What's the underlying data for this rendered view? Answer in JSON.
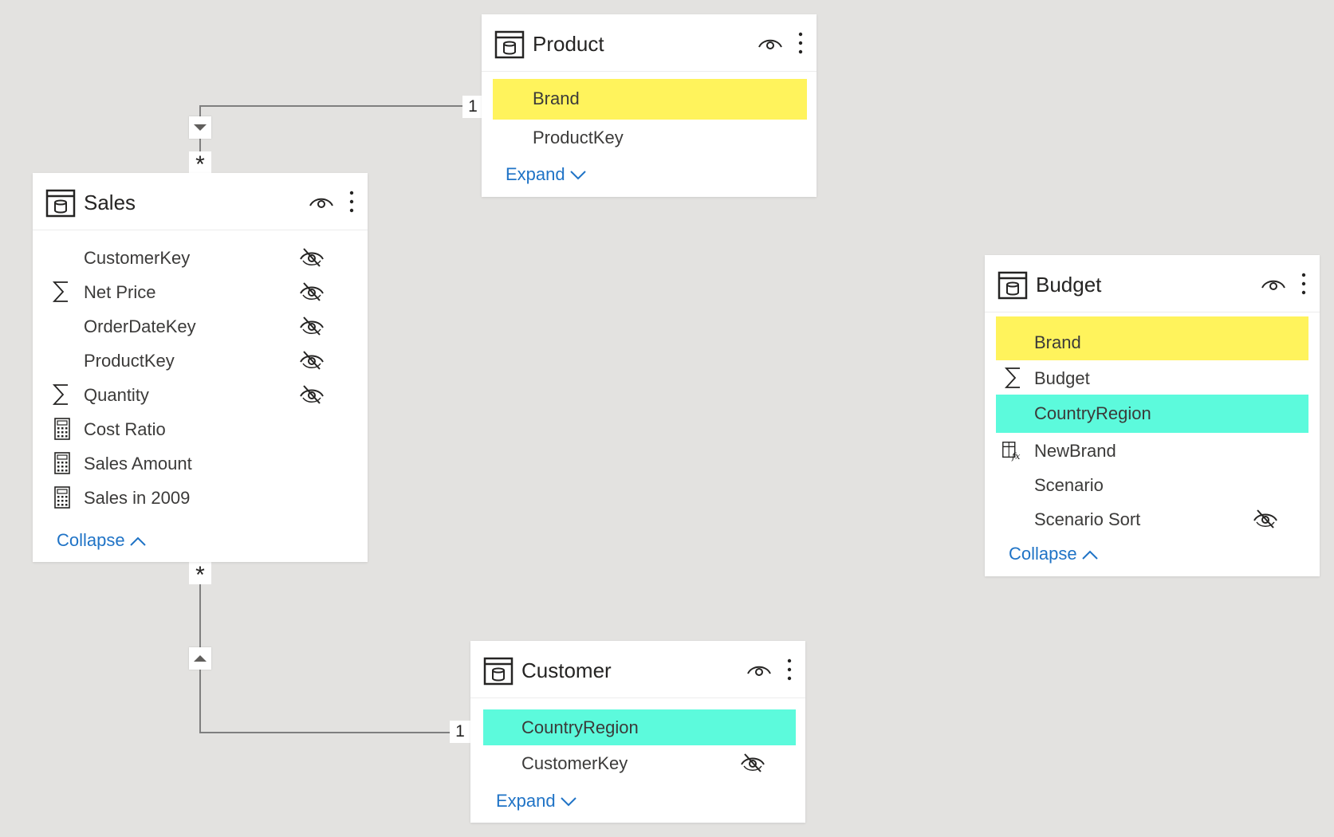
{
  "tables": {
    "product": {
      "title": "Product",
      "fields": [
        {
          "label": "Brand",
          "highlight": "#fff35c"
        },
        {
          "label": "ProductKey"
        }
      ],
      "toggle": "Expand"
    },
    "sales": {
      "title": "Sales",
      "fields": [
        {
          "label": "CustomerKey",
          "hidden": true
        },
        {
          "label": "Net Price",
          "icon": "sigma-icon",
          "hidden": true
        },
        {
          "label": "OrderDateKey",
          "hidden": true
        },
        {
          "label": "ProductKey",
          "hidden": true
        },
        {
          "label": "Quantity",
          "icon": "sigma-icon",
          "hidden": true
        },
        {
          "label": "Cost Ratio",
          "icon": "calculator-icon"
        },
        {
          "label": "Sales Amount",
          "icon": "calculator-icon"
        },
        {
          "label": "Sales in 2009",
          "icon": "calculator-icon"
        }
      ],
      "toggle": "Collapse"
    },
    "budget": {
      "title": "Budget",
      "fields": [
        {
          "label": "Brand",
          "highlight": "#fff35c"
        },
        {
          "label": "Budget",
          "icon": "sigma-icon"
        },
        {
          "label": "CountryRegion",
          "highlight": "#5cfadc"
        },
        {
          "label": "NewBrand",
          "icon": "calculated-column-icon"
        },
        {
          "label": "Scenario"
        },
        {
          "label": "Scenario Sort",
          "hidden": true
        }
      ],
      "toggle": "Collapse"
    },
    "customer": {
      "title": "Customer",
      "fields": [
        {
          "label": "CountryRegion",
          "highlight": "#5cfadc"
        },
        {
          "label": "CustomerKey",
          "hidden": true
        }
      ],
      "toggle": "Expand"
    }
  },
  "relationships": [
    {
      "from": "Sales",
      "to": "Product",
      "from_cardinality": "*",
      "to_cardinality": "1"
    },
    {
      "from": "Sales",
      "to": "Customer",
      "from_cardinality": "*",
      "to_cardinality": "1"
    }
  ],
  "colors": {
    "canvas": "#e3e2e0",
    "link": "#1f73c6",
    "highlight_yellow": "#fff35c",
    "highlight_cyan": "#5cfadc"
  }
}
